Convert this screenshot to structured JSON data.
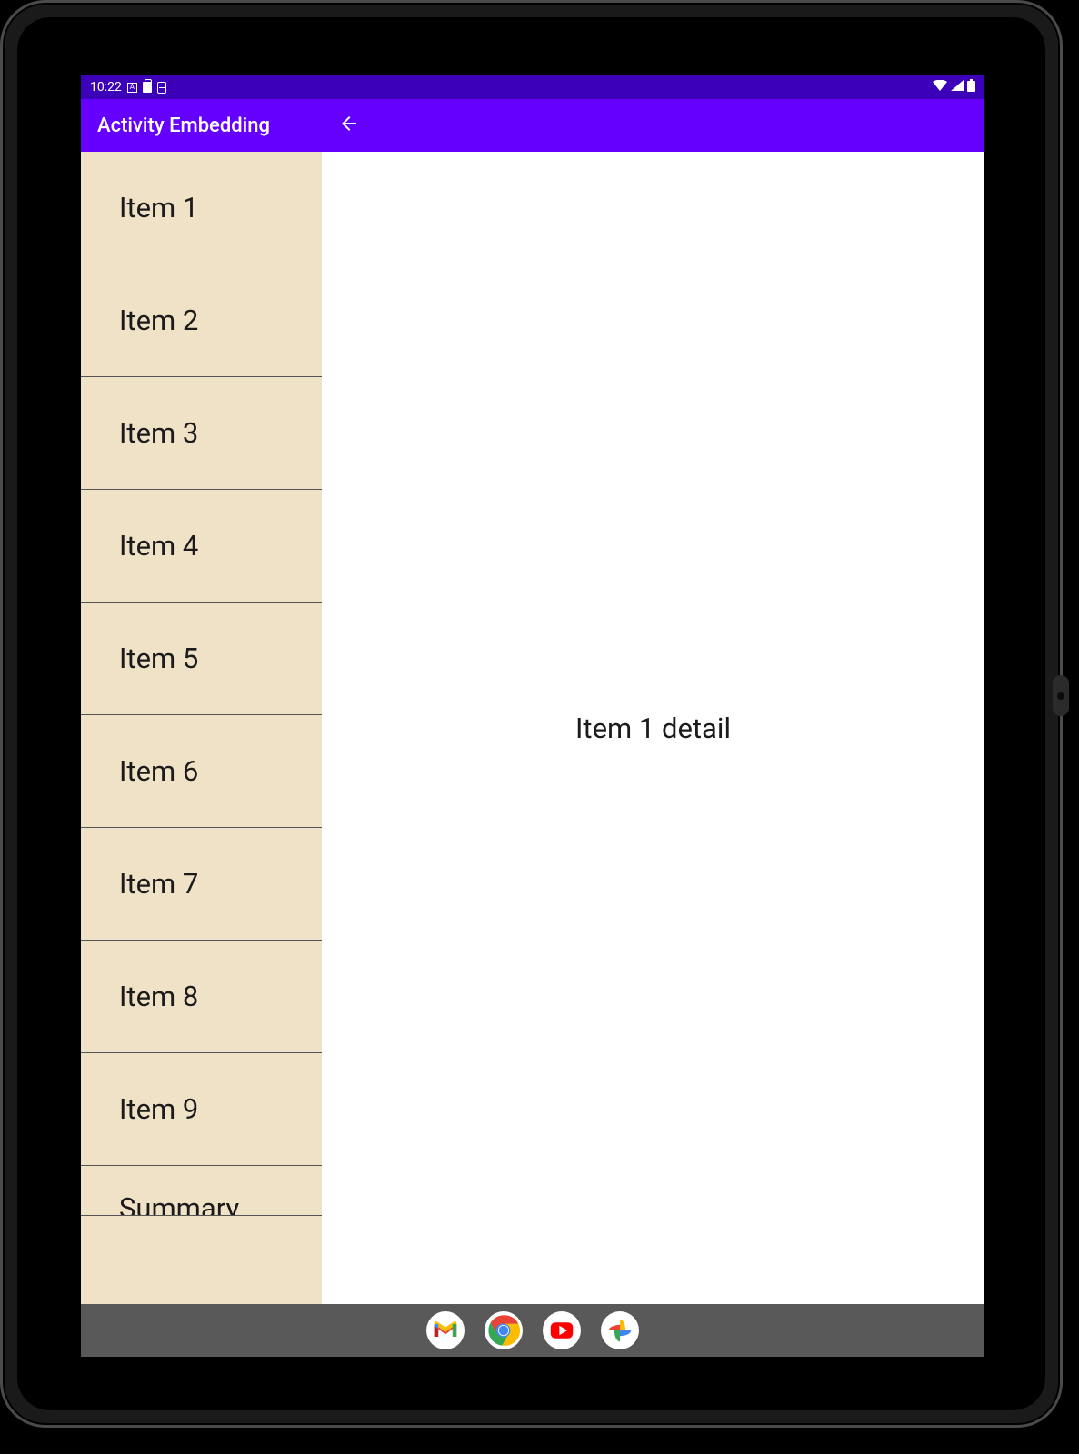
{
  "statusbar": {
    "time": "10:22"
  },
  "appbar": {
    "title": "Activity Embedding"
  },
  "list": {
    "items": [
      {
        "label": "Item 1"
      },
      {
        "label": "Item 2"
      },
      {
        "label": "Item 3"
      },
      {
        "label": "Item 4"
      },
      {
        "label": "Item 5"
      },
      {
        "label": "Item 6"
      },
      {
        "label": "Item 7"
      },
      {
        "label": "Item 8"
      },
      {
        "label": "Item 9"
      },
      {
        "label": "Summary"
      }
    ]
  },
  "detail": {
    "text": "Item 1 detail"
  },
  "colors": {
    "status_bg": "#3b00b8",
    "appbar_bg": "#6500ff",
    "list_bg": "#efe2c6",
    "nav_bg": "#595959"
  }
}
